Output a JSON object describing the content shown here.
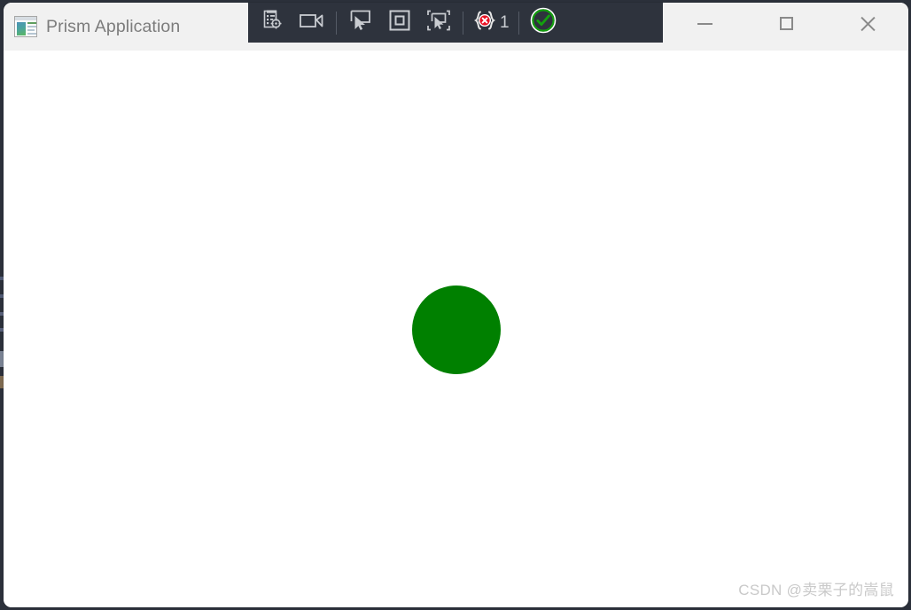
{
  "window": {
    "title": "Prism Application",
    "app_icon": "prism-app-icon",
    "background_color": "#ffffff",
    "titlebar_color": "#f1f1f1",
    "title_color": "#7c7c7c"
  },
  "vs_toolbar": {
    "background_color": "#2e333d",
    "buttons": [
      {
        "name": "go-to-live-visual-tree-icon",
        "label": "Go to Live Visual Tree"
      },
      {
        "name": "screencast-camera-icon",
        "label": "Record / Screenshot"
      },
      {
        "name": "select-element-cursor-icon",
        "label": "Enable selection"
      },
      {
        "name": "display-layout-adorners-icon",
        "label": "Display layout adorners"
      },
      {
        "name": "track-focused-element-icon",
        "label": "Track focused element"
      }
    ],
    "error_badge": {
      "name": "xaml-binding-error-badge",
      "count": "1",
      "icon_color": "#e81123",
      "count_color": "#c9ccd1"
    },
    "hot_reload": {
      "name": "hot-reload-status-icon",
      "state": "enabled",
      "color": "#13a10e"
    }
  },
  "window_controls": {
    "minimize": {
      "name": "minimize-button",
      "glyph": "minimize-icon"
    },
    "maximize": {
      "name": "maximize-button",
      "glyph": "maximize-icon"
    },
    "close": {
      "name": "close-button",
      "glyph": "close-icon"
    }
  },
  "client": {
    "shape": {
      "name": "green-ellipse",
      "type": "ellipse",
      "fill": "#008000",
      "width": 100,
      "height": 100
    },
    "watermark": "CSDN @卖栗子的嵩鼠"
  }
}
